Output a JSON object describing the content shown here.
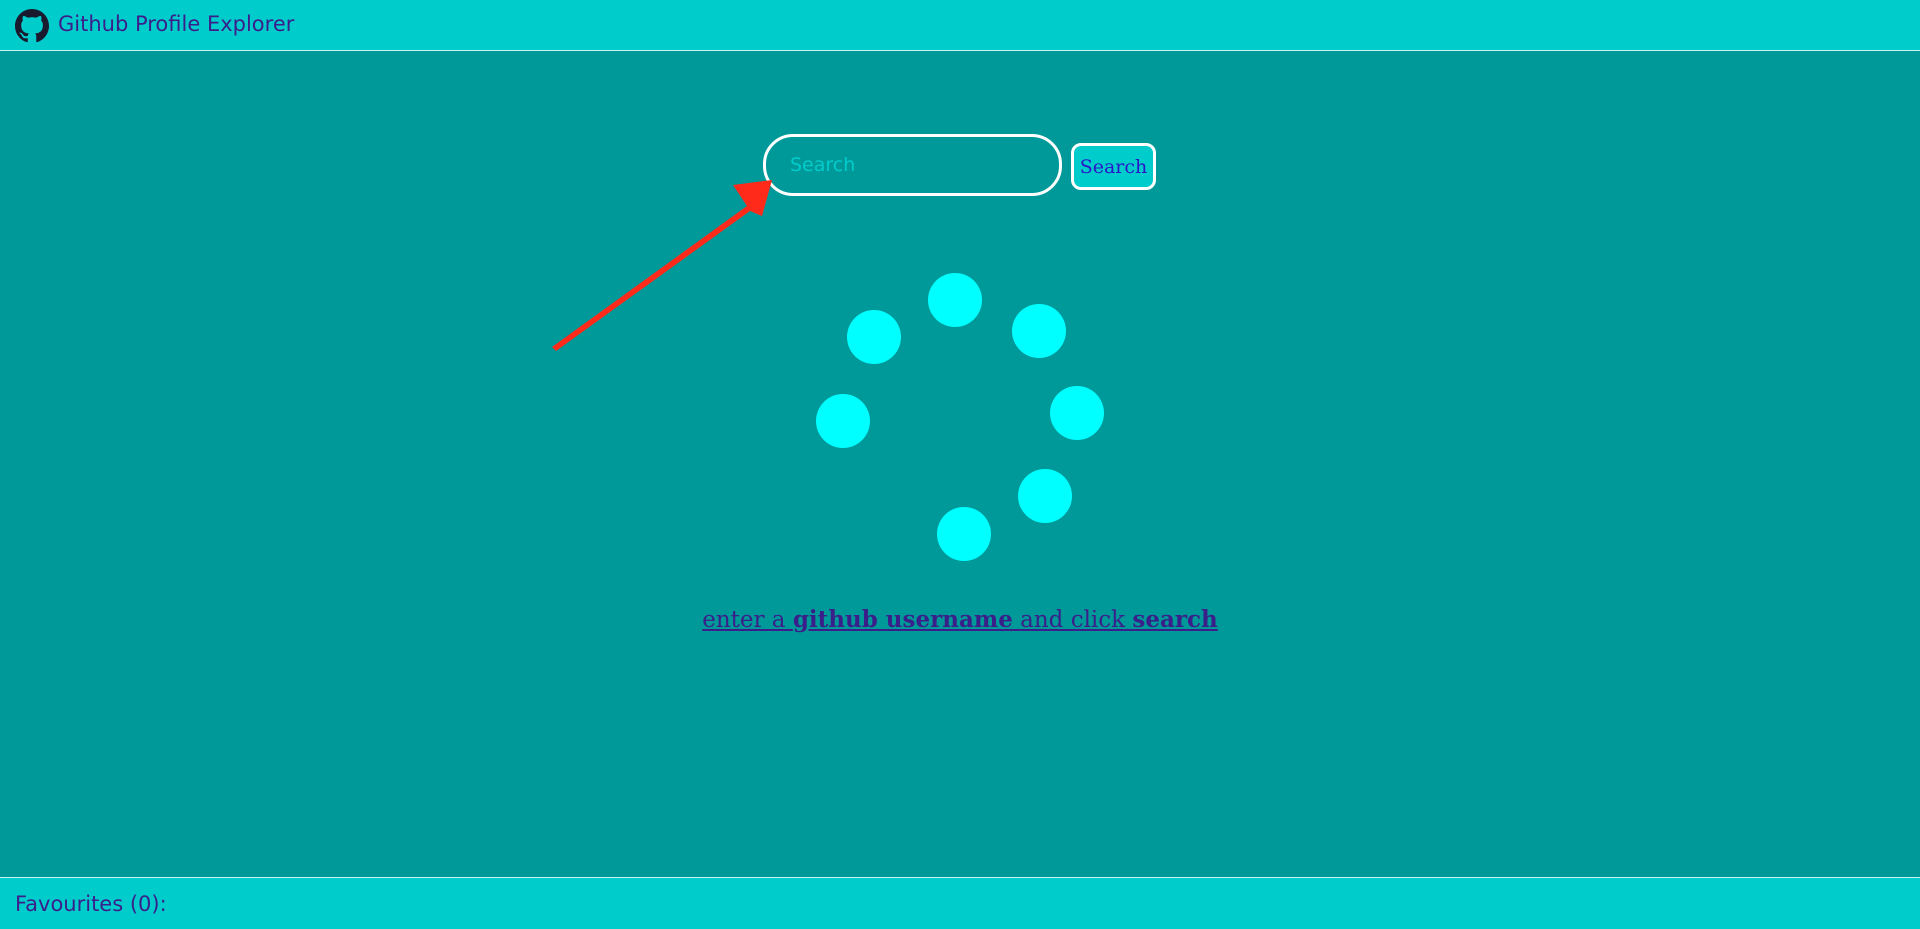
{
  "header": {
    "title": "Github Profile Explorer",
    "logo_icon": "github-octocat-icon"
  },
  "search": {
    "placeholder": "Search",
    "value": "",
    "button_label": "Search"
  },
  "annotation": {
    "icon": "red-arrow-icon",
    "color": "#ff2a1a"
  },
  "loader": {
    "icon": "spinner-icon",
    "dot_color": "#00ffff",
    "dot_count": 7
  },
  "hint": {
    "part1": "enter a ",
    "bold1": "github username",
    "part2": " and click ",
    "bold2": "search"
  },
  "footer": {
    "favourites_label": "Favourites (0):"
  },
  "colors": {
    "background": "#009999",
    "bars": "#00cccc",
    "text": "#3a1f8a",
    "button_text": "#2a16c8"
  }
}
